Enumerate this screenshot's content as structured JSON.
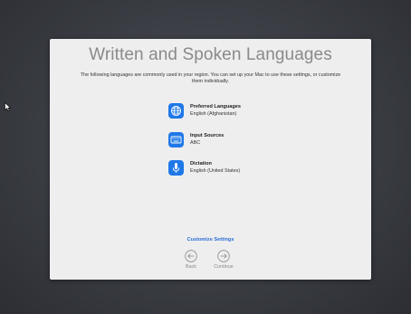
{
  "title": "Written and Spoken Languages",
  "subtitle": "The following languages are commonly used in your region. You can set up your Mac to use these settings, or customize them individually.",
  "items": [
    {
      "title": "Preferred Languages",
      "value": "English (Afghanistan)",
      "icon": "globe-icon"
    },
    {
      "title": "Input Sources",
      "value": "ABC",
      "icon": "keyboard-icon"
    },
    {
      "title": "Dictation",
      "value": "English (United States)",
      "icon": "microphone-icon"
    }
  ],
  "customize_label": "Customize Settings",
  "nav": {
    "back_label": "Back",
    "continue_label": "Continue"
  },
  "colors": {
    "accent": "#1f78e8",
    "link": "#2a6fd6",
    "panel": "#eeeeee",
    "desktop": "#3a3d43"
  }
}
